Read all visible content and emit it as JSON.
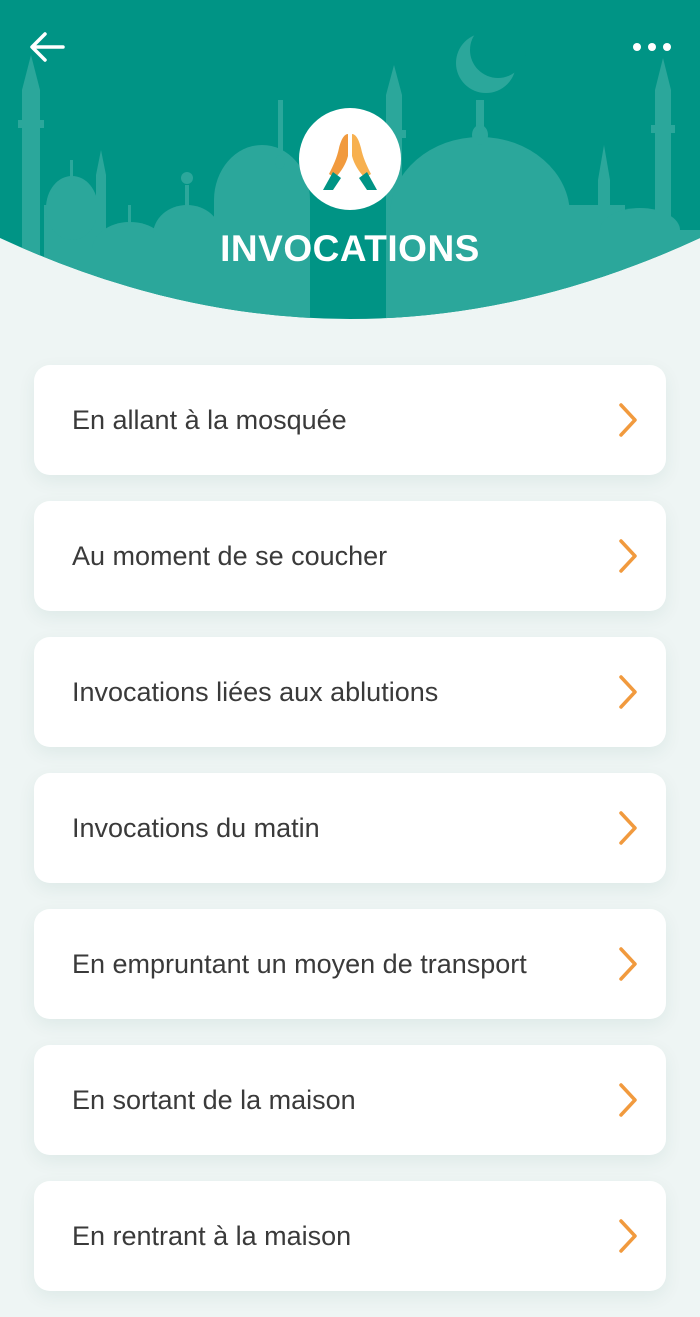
{
  "header": {
    "title": "INVOCATIONS",
    "back_icon": "arrow-left-icon",
    "menu_icon": "more-horizontal-icon",
    "emblem_icon": "praying-hands-icon",
    "background_color": "#009485",
    "silhouette_color": "#2ba79b"
  },
  "accent_color": "#f19a3e",
  "items": [
    {
      "label": "En allant à la mosquée"
    },
    {
      "label": "Au moment de se coucher"
    },
    {
      "label": "Invocations liées aux ablutions"
    },
    {
      "label": "Invocations du matin"
    },
    {
      "label": "En empruntant un moyen de transport"
    },
    {
      "label": "En sortant de la maison"
    },
    {
      "label": "En rentrant à la maison"
    }
  ]
}
